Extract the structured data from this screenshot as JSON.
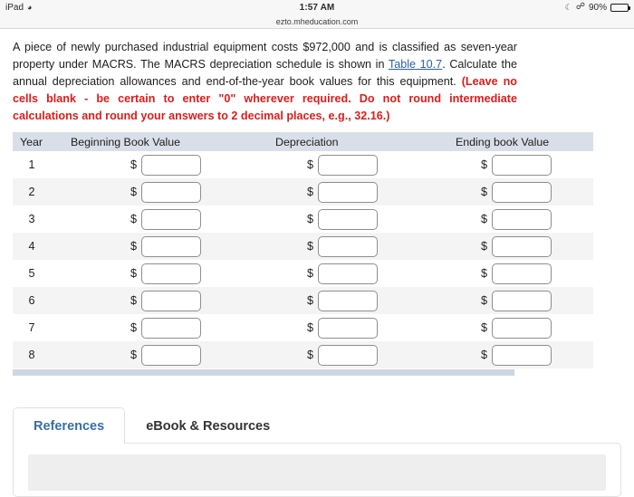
{
  "statusbar": {
    "device": "iPad",
    "wifi_icon": "wifi-icon",
    "time": "1:57 AM",
    "dnd_icon": "moon-do-not-disturb-icon",
    "bluetooth_icon": "bluetooth-icon",
    "battery_percent": "90%",
    "battery_icon": "battery-icon"
  },
  "browser": {
    "url": "ezto.mheducation.com"
  },
  "question": {
    "part1": "A piece of newly purchased industrial equipment costs $972,000 and is classified as seven-year property under MACRS. The MACRS depreciation schedule is shown in ",
    "link": "Table 10.7",
    "part2": ". Calculate the annual depreciation allowances and end-of-the-year book values for this equipment. ",
    "instruction": "(Leave no cells blank - be certain to enter \"0\" wherever required. Do not round intermediate calculations and round your answers to 2 decimal places, e.g., 32.16.)"
  },
  "table": {
    "headers": {
      "year": "Year",
      "beginning": "Beginning Book Value",
      "depreciation": "Depreciation",
      "ending": "Ending book Value"
    },
    "currency_symbol": "$",
    "input_placeholder": "",
    "rows": [
      {
        "year": "1",
        "beginning": "",
        "depreciation": "",
        "ending": ""
      },
      {
        "year": "2",
        "beginning": "",
        "depreciation": "",
        "ending": ""
      },
      {
        "year": "3",
        "beginning": "",
        "depreciation": "",
        "ending": ""
      },
      {
        "year": "4",
        "beginning": "",
        "depreciation": "",
        "ending": ""
      },
      {
        "year": "5",
        "beginning": "",
        "depreciation": "",
        "ending": ""
      },
      {
        "year": "6",
        "beginning": "",
        "depreciation": "",
        "ending": ""
      },
      {
        "year": "7",
        "beginning": "",
        "depreciation": "",
        "ending": ""
      },
      {
        "year": "8",
        "beginning": "",
        "depreciation": "",
        "ending": ""
      }
    ]
  },
  "tabs": [
    {
      "label": "References",
      "active": true
    },
    {
      "label": "eBook & Resources",
      "active": false
    }
  ],
  "colors": {
    "header_bg": "#d9dfe9",
    "footer_bar": "#ced5e2",
    "link": "#2b5faa",
    "warning_text": "#e01b1b",
    "active_tab_text": "#3a6ea5",
    "row_alt_bg": "#f4f4f5"
  }
}
